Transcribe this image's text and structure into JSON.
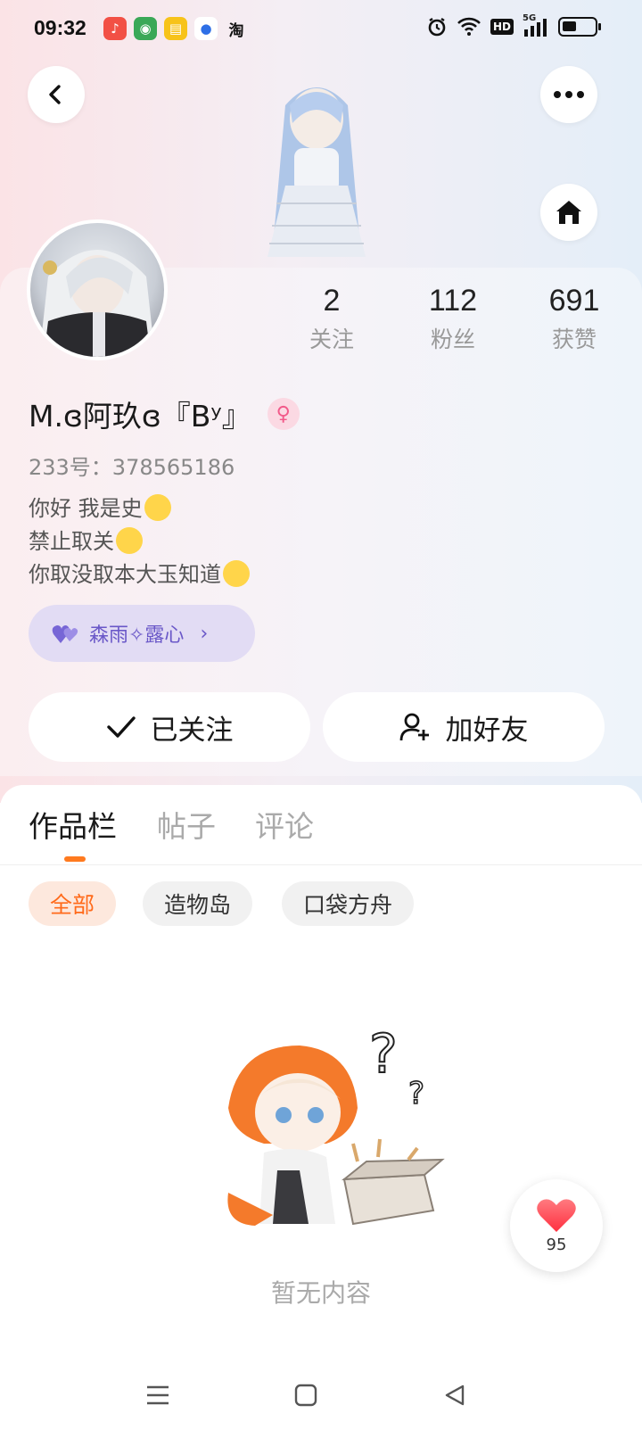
{
  "status_bar": {
    "time": "09:32",
    "apps": [
      {
        "icon": "music-app-icon",
        "color": "#f25045",
        "glyph": "♪"
      },
      {
        "icon": "game-app-icon",
        "color": "#3aa857",
        "glyph": "◉"
      },
      {
        "icon": "notes-app-icon",
        "color": "#f7c31a",
        "glyph": "▤"
      },
      {
        "icon": "baidu-app-icon",
        "color": "#2e6fe6",
        "glyph": "🐾"
      },
      {
        "icon": "taobao-app-icon",
        "color": "#ffffff",
        "glyph": "淘"
      }
    ],
    "network": "5G",
    "hd": "HD",
    "battery_level": 0.45
  },
  "header": {
    "back_icon": "back-icon",
    "more_icon": "more-icon",
    "home_icon": "home-icon"
  },
  "profile": {
    "stats": [
      {
        "value": "2",
        "label": "关注"
      },
      {
        "value": "112",
        "label": "粉丝"
      },
      {
        "value": "691",
        "label": "获赞"
      }
    ],
    "username": "M.ɞ阿玖ɞ『Bʸ』",
    "gender_symbol": "♀",
    "uid": "233号：378565186",
    "bio_lines": [
      "你好 我是史",
      "禁止取关",
      "你取没取本大玉知道"
    ],
    "group_tag": "森雨✧露心"
  },
  "actions": {
    "following_label": "已关注",
    "add_friend_label": "加好友"
  },
  "tabs": [
    "作品栏",
    "帖子",
    "评论"
  ],
  "filters": [
    "全部",
    "造物岛",
    "口袋方舟"
  ],
  "empty_state": {
    "text": "暂无内容"
  },
  "like_fab": {
    "count": "95"
  },
  "colors": {
    "accent": "#ff7a1f",
    "group_tag_bg": "#e2dcf4",
    "group_tag_text": "#6a58c8",
    "like_red": "#ff4d5a"
  }
}
